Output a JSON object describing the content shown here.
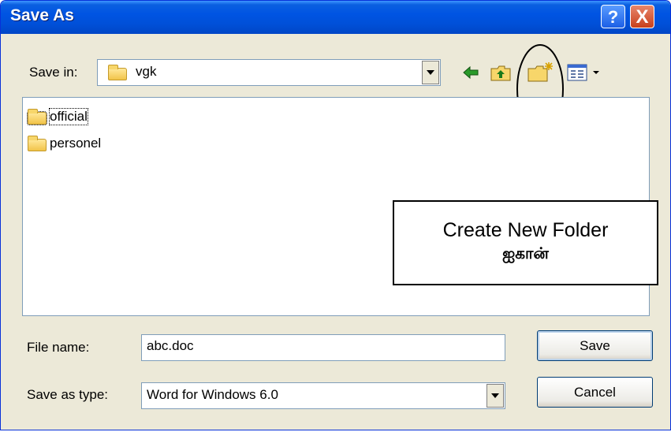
{
  "dialog": {
    "title": "Save As"
  },
  "titlebar": {
    "help_glyph": "?",
    "close_glyph": "X"
  },
  "save_in": {
    "label": "Save in:",
    "value": "vgk"
  },
  "toolbar": {
    "icons": [
      "back-arrow-icon",
      "up-one-level-icon",
      "create-new-folder-icon",
      "views-menu-icon"
    ]
  },
  "files": [
    {
      "name": "official"
    },
    {
      "name": "personel"
    }
  ],
  "callout": {
    "line1": "Create New Folder",
    "line2": "ஐகான்"
  },
  "file_name": {
    "label": "File name:",
    "value": "abc.doc"
  },
  "save_as_type": {
    "label": "Save as type:",
    "value": "Word for Windows 6.0"
  },
  "buttons": {
    "save": "Save",
    "cancel": "Cancel"
  },
  "colors": {
    "titlebar": "#0054e3",
    "dialog_bg": "#ece9d8",
    "close": "#c8401c",
    "back_arrow": "#2a9a2a"
  }
}
